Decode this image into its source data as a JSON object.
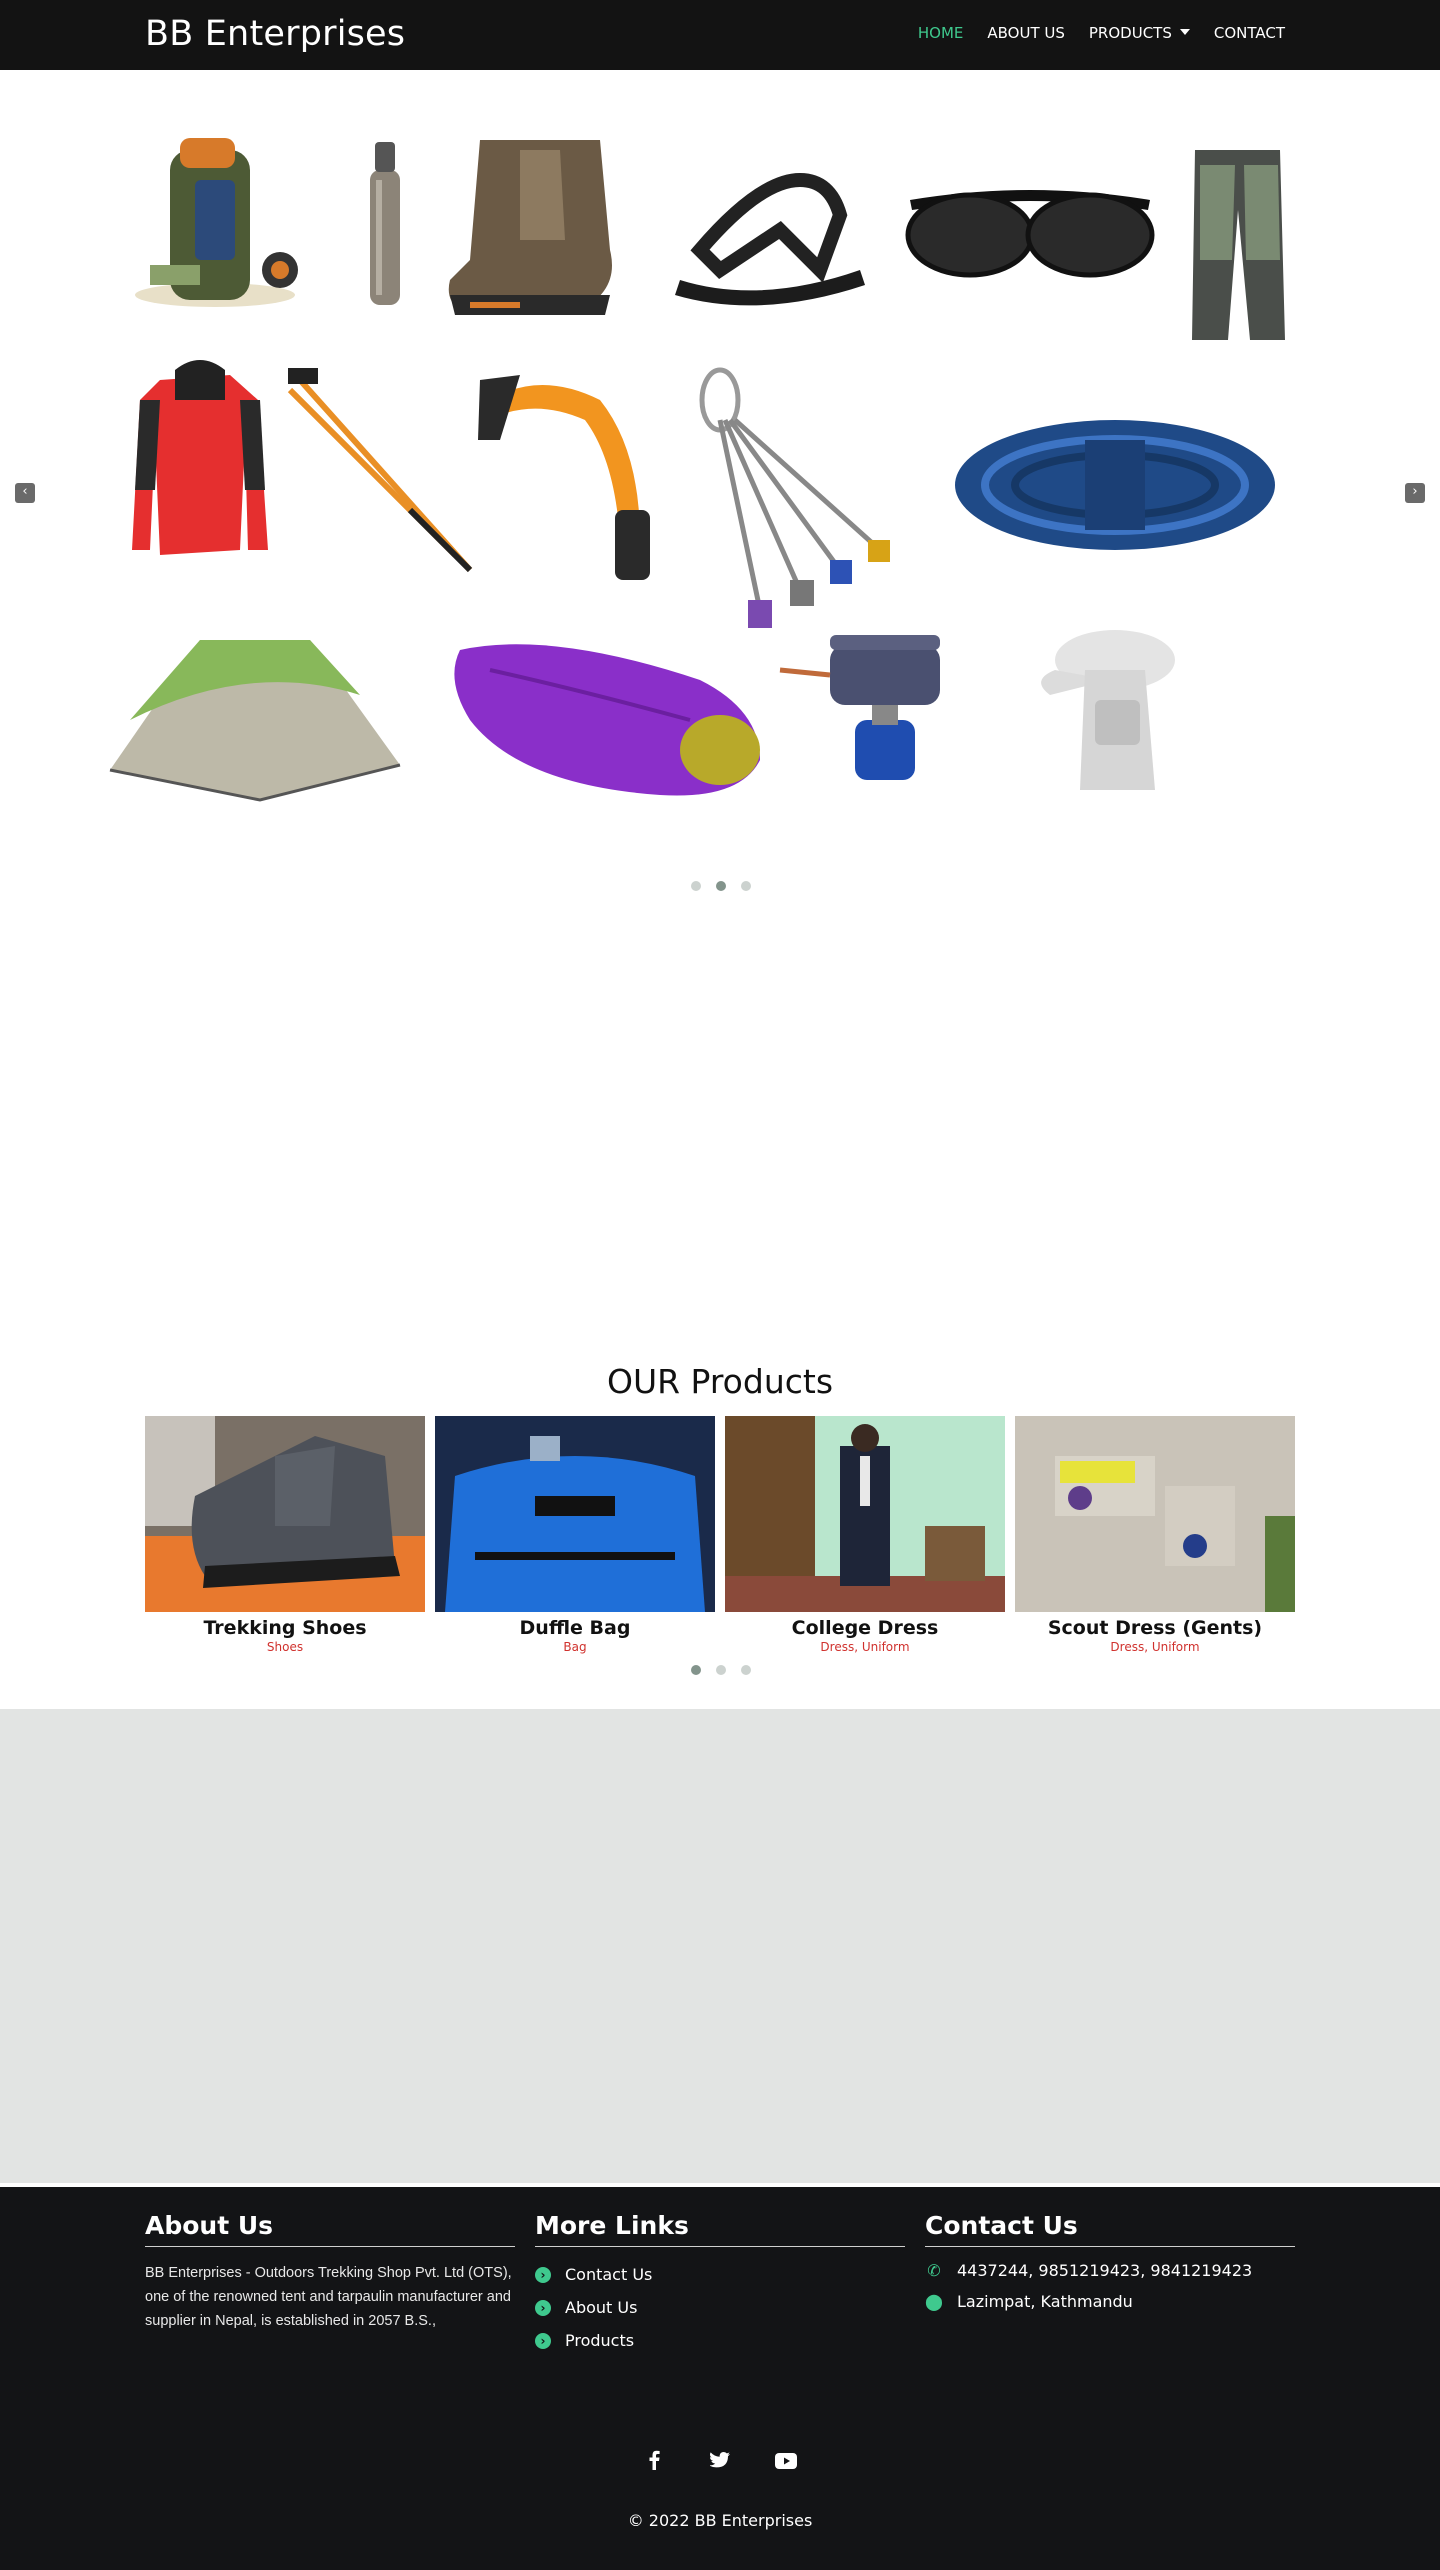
{
  "brand": "BB Enterprises",
  "nav": {
    "home": "HOME",
    "about": "ABOUT US",
    "products": "PRODUCTS",
    "contact": "CONTACT"
  },
  "colors": {
    "accent": "#3fc98e",
    "navbar": "#131313",
    "footer": "#131416",
    "category": "#d0312d",
    "band": "#e2e4e3"
  },
  "hero": {
    "prev_icon": "‹",
    "next_icon": "›",
    "items": [
      "backpack",
      "water-bottle",
      "hiking-boot",
      "sandal",
      "sunglasses",
      "trekking-pants",
      "rain-jacket",
      "trekking-poles",
      "ice-axe",
      "climbing-cams",
      "climbing-rope",
      "tent",
      "sleeping-bag",
      "camping-stove",
      "sun-hat"
    ],
    "active_slide": 2,
    "slide_count": 3
  },
  "products": {
    "title": "OUR Products",
    "active_slide": 1,
    "slide_count": 3,
    "items": [
      {
        "name": "Trekking Shoes",
        "category": "Shoes"
      },
      {
        "name": "Duffle Bag",
        "category": "Bag"
      },
      {
        "name": "College Dress",
        "category": "Dress, Uniform"
      },
      {
        "name": "Scout Dress (Gents)",
        "category": "Dress, Uniform"
      }
    ]
  },
  "footer": {
    "about_title": "About Us",
    "about_text": "BB Enterprises - Outdoors Trekking Shop Pvt. Ltd (OTS), one of the renowned tent and tarpaulin manufacturer and supplier in Nepal, is established in 2057 B.S.,",
    "links_title": "More Links",
    "links": [
      "Contact Us",
      "About Us",
      "Products"
    ],
    "contact_title": "Contact Us",
    "phone": "4437244, 9851219423, 9841219423",
    "address": "Lazimpat, Kathmandu",
    "social": [
      "facebook-icon",
      "twitter-icon",
      "youtube-icon"
    ],
    "copyright": "© 2022 BB Enterprises"
  }
}
